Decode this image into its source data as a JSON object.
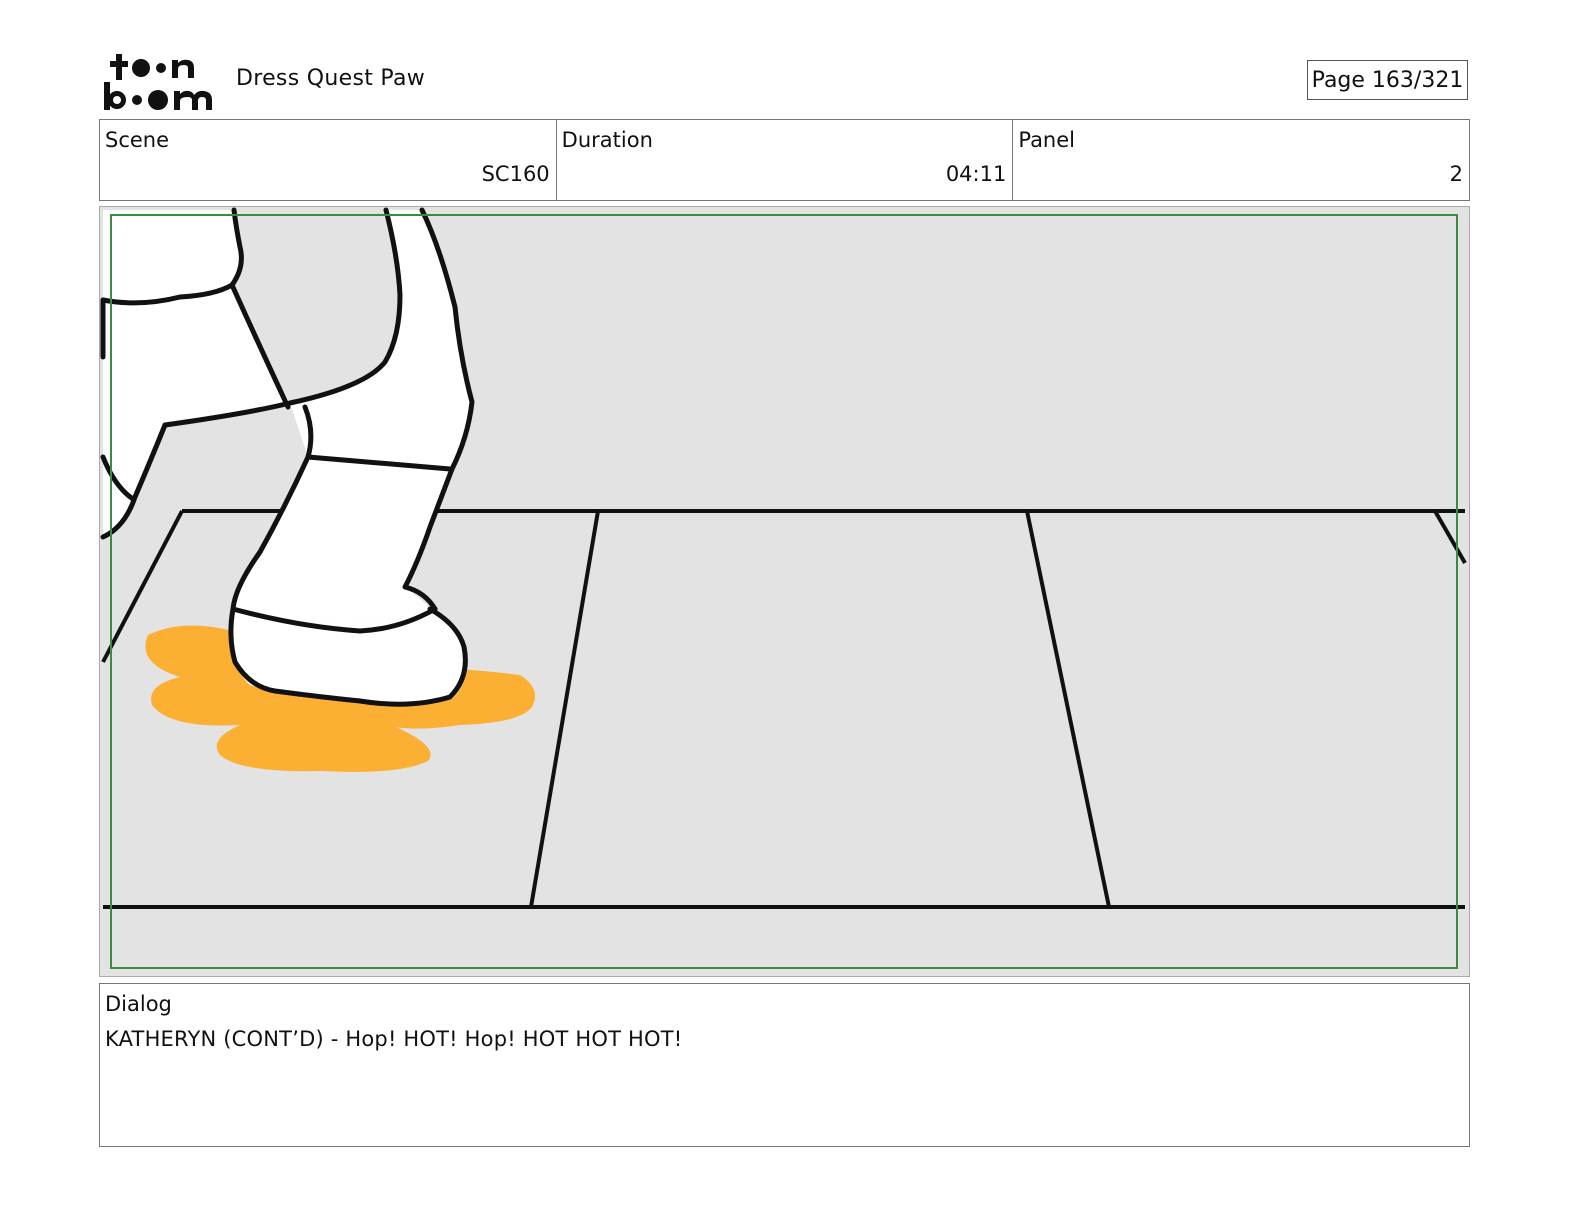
{
  "header": {
    "logo_text": "toon boom",
    "project_title": "Dress Quest Paw",
    "page_label": "Page 163/321"
  },
  "info": {
    "scene_label": "Scene",
    "scene_value": "SC160",
    "duration_label": "Duration",
    "duration_value": "04:11",
    "panel_label": "Panel",
    "panel_value": "2"
  },
  "dialog": {
    "label": "Dialog",
    "text": "KATHERYN (CONT’D) - Hop! HOT! Hop! HOT HOT HOT!"
  },
  "colors": {
    "panel_bg": "#e3e3e3",
    "safe_area_border": "#3e8a3e",
    "puddle": "#fbb034",
    "line_art": "#111111"
  }
}
